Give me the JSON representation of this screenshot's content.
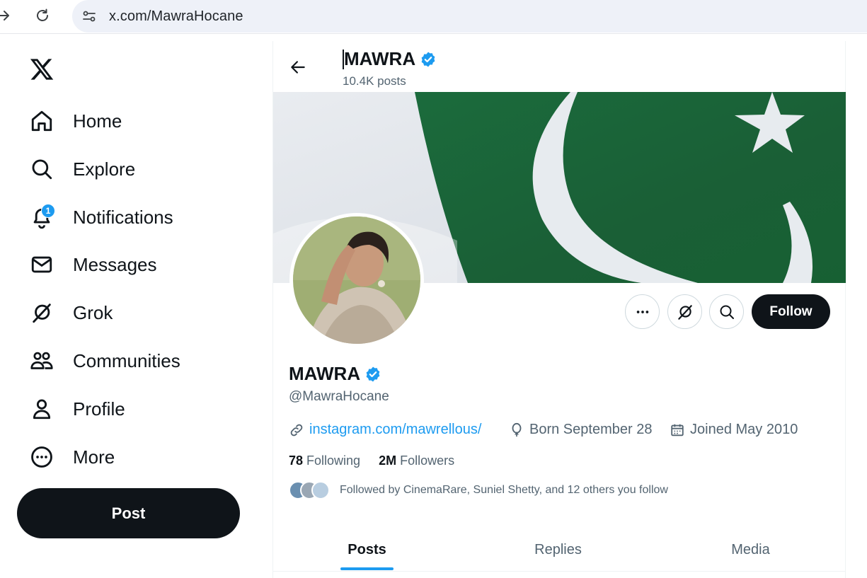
{
  "browser": {
    "url": "x.com/MawraHocane"
  },
  "sidebar": {
    "items": [
      {
        "label": "Home",
        "icon": "home-icon"
      },
      {
        "label": "Explore",
        "icon": "search-icon"
      },
      {
        "label": "Notifications",
        "icon": "bell-icon",
        "badge": "1"
      },
      {
        "label": "Messages",
        "icon": "envelope-icon"
      },
      {
        "label": "Grok",
        "icon": "grok-icon"
      },
      {
        "label": "Communities",
        "icon": "people-icon"
      },
      {
        "label": "Profile",
        "icon": "person-icon"
      },
      {
        "label": "More",
        "icon": "more-circle-icon"
      }
    ],
    "post_label": "Post"
  },
  "header": {
    "name": "MAWRA",
    "posts_count": "10.4K posts"
  },
  "profile": {
    "name": "MAWRA",
    "handle": "@MawraHocane",
    "website": "instagram.com/mawrellous/",
    "born": "Born September 28",
    "joined": "Joined May 2010",
    "following_count": "78",
    "following_label": "Following",
    "followers_count": "2M",
    "followers_label": "Followers",
    "followed_by": "Followed by CinemaRare, Suniel Shetty, and 12 others you follow",
    "follow_label": "Follow"
  },
  "tabs": [
    {
      "label": "Posts",
      "active": true
    },
    {
      "label": "Replies",
      "active": false
    },
    {
      "label": "Media",
      "active": false
    }
  ],
  "colors": {
    "accent": "#1d9bf0",
    "text": "#0f1419",
    "secondary_text": "#536471",
    "flag_green": "#1e6b3a"
  }
}
